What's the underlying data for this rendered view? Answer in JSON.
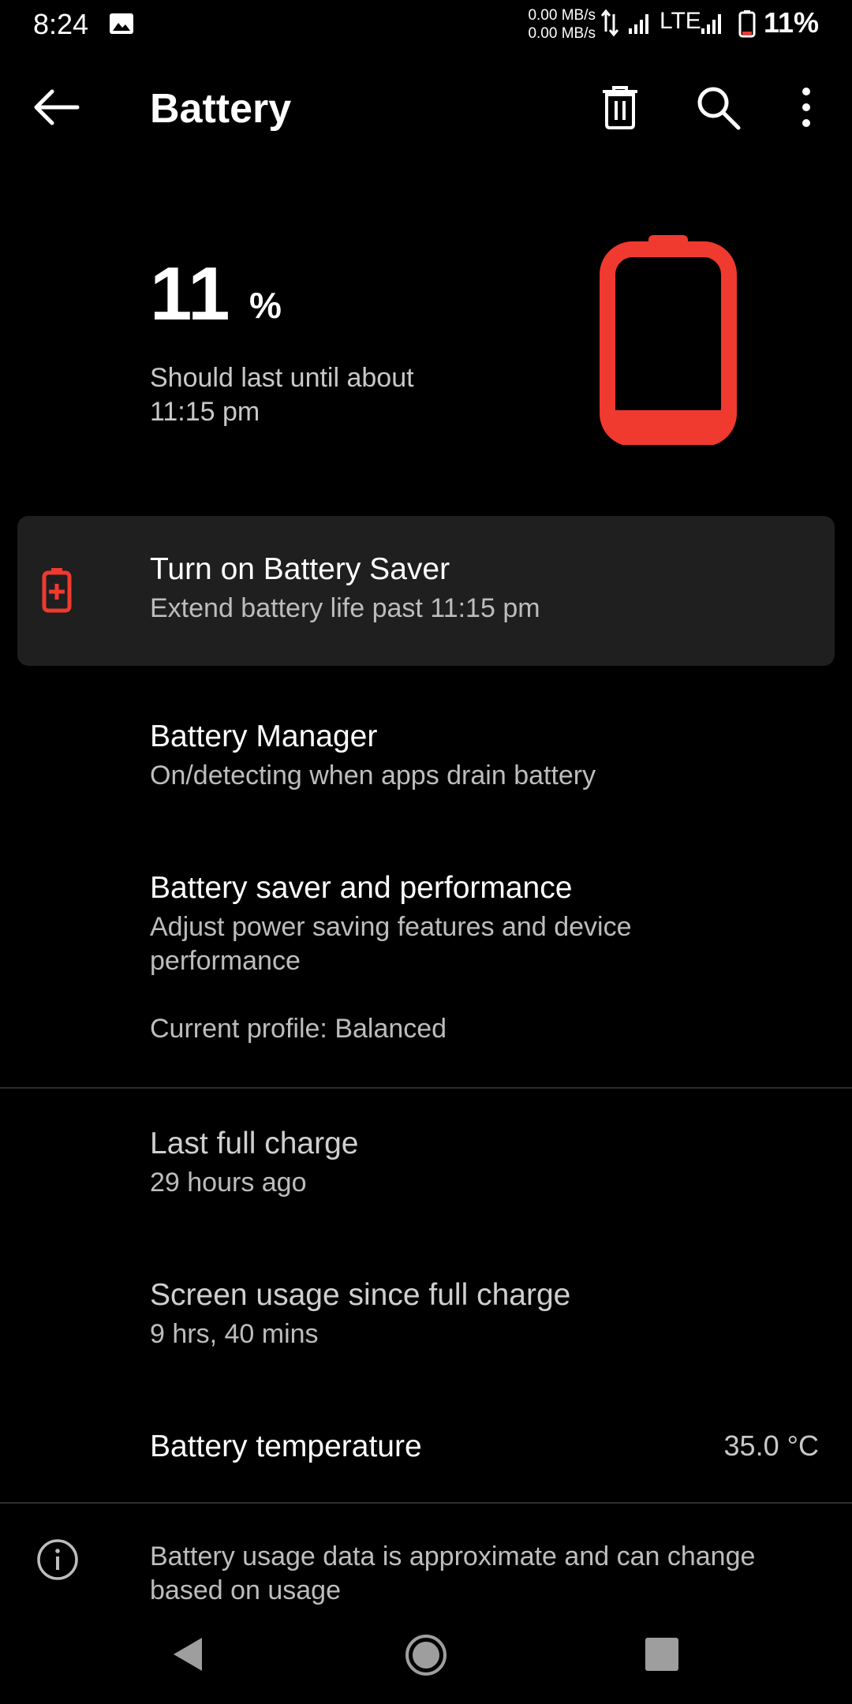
{
  "status_bar": {
    "time": "8:24",
    "rate_up": "0.00 MB/s",
    "rate_down": "0.00 MB/s",
    "network": "LTE",
    "battery_percent": "11%"
  },
  "toolbar": {
    "title": "Battery",
    "icons": [
      "back-arrow-icon",
      "trash-icon",
      "search-icon",
      "more-vert-icon"
    ]
  },
  "hero": {
    "level": "11",
    "percent_sign": "%",
    "estimate_line1": "Should last until about",
    "estimate_line2": "11:15 pm",
    "battery_color": "#F0392F"
  },
  "saver_card": {
    "title": "Turn on Battery Saver",
    "subtitle": "Extend battery life past 11:15 pm"
  },
  "items": {
    "manager": {
      "title": "Battery Manager",
      "subtitle": "On/detecting when apps drain battery"
    },
    "saver_performance": {
      "title": "Battery saver and performance",
      "subtitle_line1": "Adjust power saving features and device",
      "subtitle_line2": "performance",
      "profile": "Current profile: Balanced"
    },
    "last_charge": {
      "title": "Last full charge",
      "value": "29 hours ago"
    },
    "screen_usage": {
      "title": "Screen usage since full charge",
      "value": "9 hrs, 40 mins"
    },
    "temperature": {
      "title": "Battery temperature",
      "value": "35.0 °C"
    }
  },
  "footer": {
    "line1": "Battery usage data is approximate and can change",
    "line2": "based on usage"
  },
  "colors": {
    "accent": "#F0392F",
    "background": "#000000",
    "card": "#1F1F1F"
  }
}
